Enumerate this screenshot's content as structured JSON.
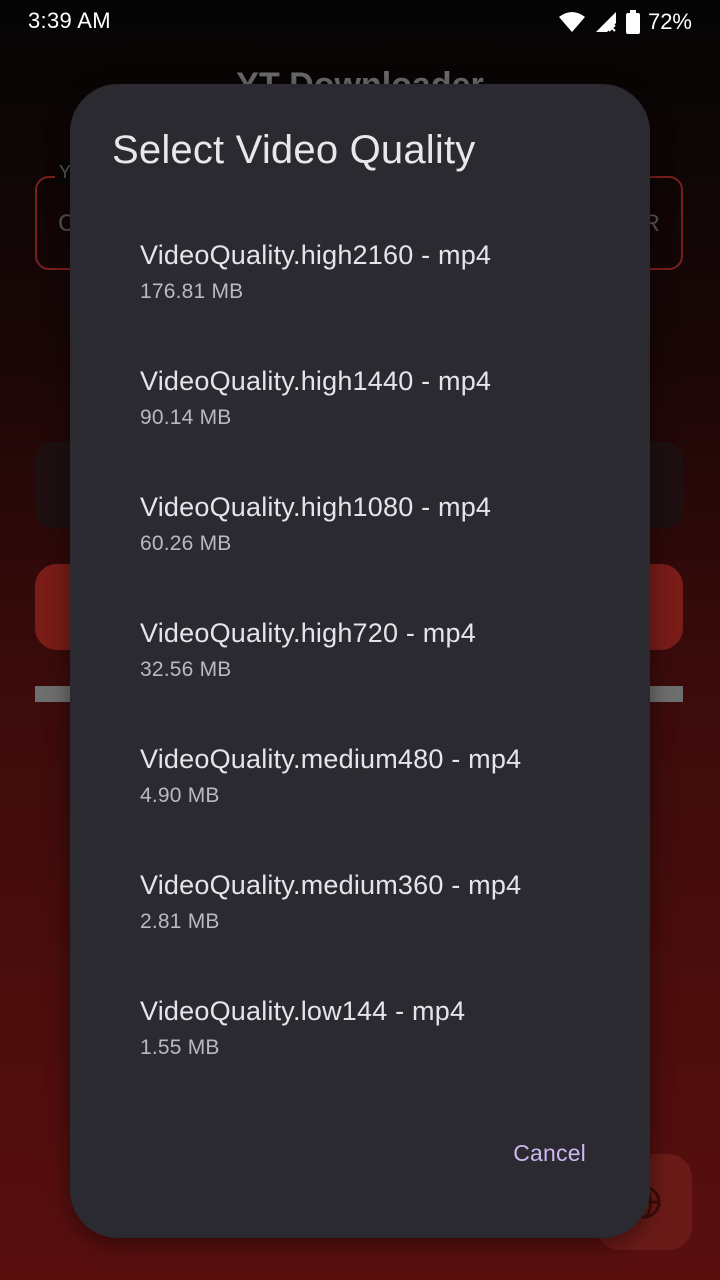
{
  "status_bar": {
    "time": "3:39 AM",
    "battery_percent": "72%",
    "icons": [
      "wifi-icon",
      "signal-no-service-icon",
      "battery-icon"
    ]
  },
  "background_app": {
    "title": "YT Downloader",
    "input_label": "Y",
    "input_prefix": "C",
    "input_suffix": "R",
    "accent_color": "#7a1c18"
  },
  "dialog": {
    "title": "Select Video Quality",
    "options": [
      {
        "label": "VideoQuality.high2160 - mp4",
        "size": "176.81 MB"
      },
      {
        "label": "VideoQuality.high1440 - mp4",
        "size": "90.14 MB"
      },
      {
        "label": "VideoQuality.high1080 - mp4",
        "size": "60.26 MB"
      },
      {
        "label": "VideoQuality.high720 - mp4",
        "size": "32.56 MB"
      },
      {
        "label": "VideoQuality.medium480 - mp4",
        "size": "4.90 MB"
      },
      {
        "label": "VideoQuality.medium360 - mp4",
        "size": "2.81 MB"
      },
      {
        "label": "VideoQuality.low144 - mp4",
        "size": "1.55 MB"
      }
    ],
    "cancel_label": "Cancel",
    "colors": {
      "surface": "#2b2a30",
      "accent": "#cdb8f2"
    }
  }
}
